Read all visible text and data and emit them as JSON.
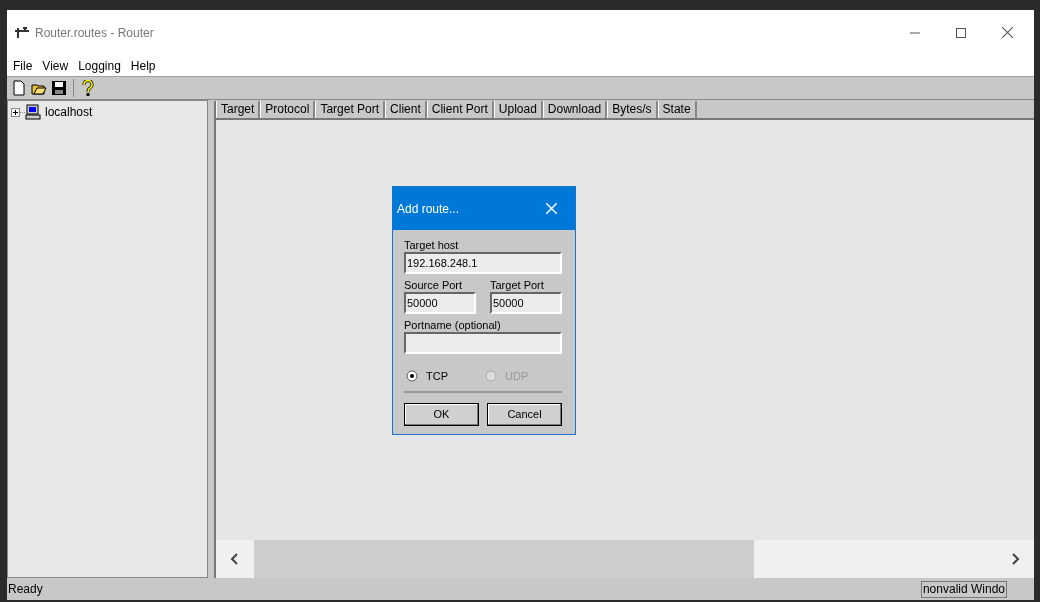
{
  "window": {
    "title": "Router.routes - Router"
  },
  "menu": [
    "File",
    "View",
    "Logging",
    "Help"
  ],
  "tree": [
    {
      "label": "localhost",
      "expanded": false
    }
  ],
  "table": {
    "columns": [
      "Target",
      "Protocol",
      "Target Port",
      "Client",
      "Client Port",
      "Upload",
      "Download",
      "Bytes/s",
      "State"
    ]
  },
  "dialog": {
    "title": "Add route...",
    "field_rows": [
      [
        {
          "label": "Target host",
          "value": "192.168.248.1"
        }
      ],
      [
        {
          "label": "Source Port",
          "value": "50000"
        },
        {
          "label": "Target Port",
          "value": "50000"
        }
      ],
      [
        {
          "label": "Portname (optional)"
        }
      ]
    ],
    "radios": [
      {
        "label": "TCP",
        "selected": true,
        "disabled": false
      },
      {
        "label": "UDP",
        "selected": false,
        "disabled": true
      }
    ],
    "buttons": [
      "OK",
      "Cancel"
    ]
  },
  "status_bar": {
    "message": "Ready",
    "panel": "nonvalid Windo"
  }
}
